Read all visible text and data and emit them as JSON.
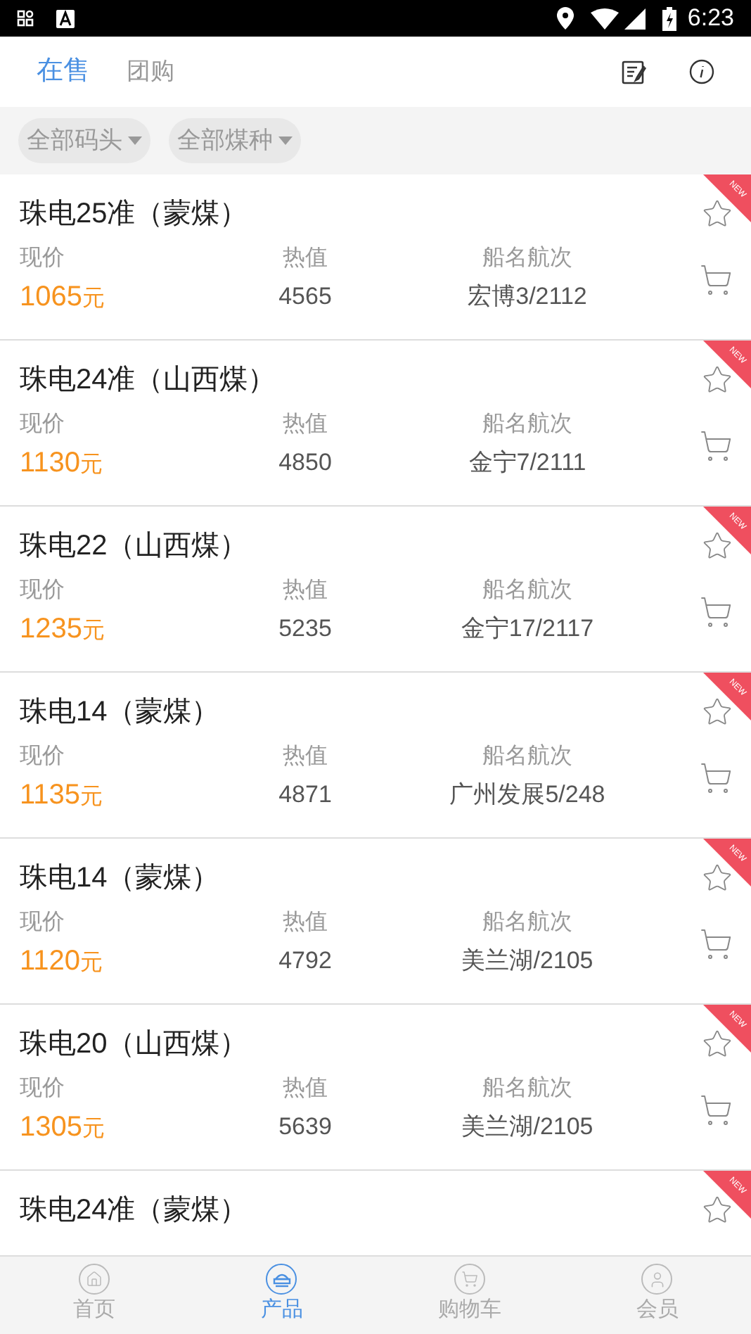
{
  "status_bar": {
    "time": "6:23"
  },
  "tabs": [
    {
      "label": "在售",
      "selected": true
    },
    {
      "label": "团购",
      "selected": false
    }
  ],
  "filters": [
    {
      "label": "全部码头"
    },
    {
      "label": "全部煤种"
    }
  ],
  "products": [
    {
      "title": "珠电25准（蒙煤）",
      "badge": "NEW",
      "labels": [
        "现价",
        "热值",
        "船名航次"
      ],
      "price": "1065",
      "unit": "元",
      "heat": "4565",
      "ship": "宏博3/2112"
    },
    {
      "title": "珠电24准（山西煤）",
      "badge": "NEW",
      "labels": [
        "现价",
        "热值",
        "船名航次"
      ],
      "price": "1130",
      "unit": "元",
      "heat": "4850",
      "ship": "金宁7/2111"
    },
    {
      "title": "珠电22（山西煤）",
      "badge": "NEW",
      "labels": [
        "现价",
        "热值",
        "船名航次"
      ],
      "price": "1235",
      "unit": "元",
      "heat": "5235",
      "ship": "金宁17/2117"
    },
    {
      "title": "珠电14（蒙煤）",
      "badge": "NEW",
      "labels": [
        "现价",
        "热值",
        "船名航次"
      ],
      "price": "1135",
      "unit": "元",
      "heat": "4871",
      "ship": "广州发展5/248"
    },
    {
      "title": "珠电14（蒙煤）",
      "badge": "NEW",
      "labels": [
        "现价",
        "热值",
        "船名航次"
      ],
      "price": "1120",
      "unit": "元",
      "heat": "4792",
      "ship": "美兰湖/2105"
    },
    {
      "title": "珠电20（山西煤）",
      "badge": "NEW",
      "labels": [
        "现价",
        "热值",
        "船名航次"
      ],
      "price": "1305",
      "unit": "元",
      "heat": "5639",
      "ship": "美兰湖/2105"
    },
    {
      "title": "珠电24准（蒙煤）",
      "badge": "NEW"
    }
  ],
  "bottom_nav": [
    {
      "label": "首页",
      "kind": "home",
      "selected": false
    },
    {
      "label": "产品",
      "kind": "product",
      "selected": true
    },
    {
      "label": "购物车",
      "kind": "cart",
      "selected": false
    },
    {
      "label": "会员",
      "kind": "member",
      "selected": false
    }
  ]
}
